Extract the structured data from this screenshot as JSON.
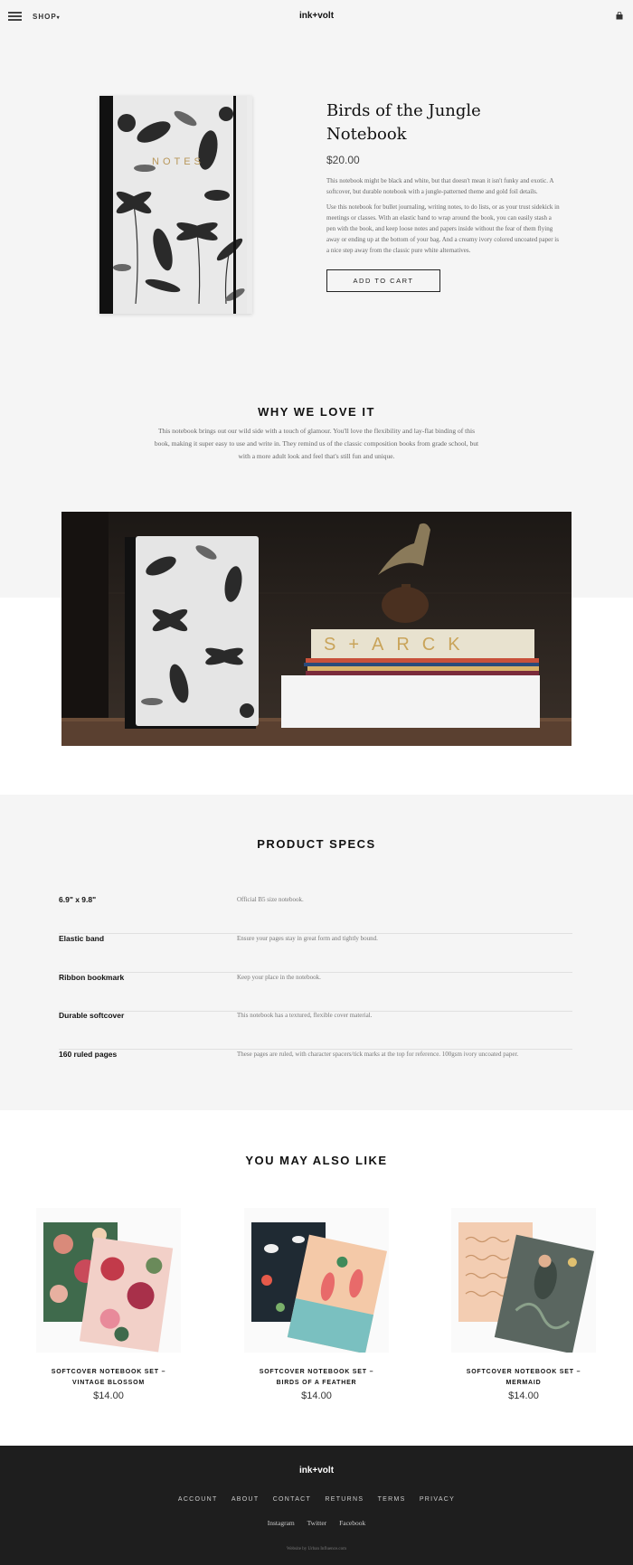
{
  "header": {
    "shop_label": "SHOP",
    "logo": "ink+volt"
  },
  "product": {
    "title": "Birds of the Jungle Notebook",
    "price": "$20.00",
    "cover_text": "NOTES",
    "description_1": "This notebook might be black and white, but that doesn't mean it isn't funky and exotic. A softcover, but durable notebook with a jungle-patterned theme and gold foil details.",
    "description_2": "Use this notebook for bullet journaling, writing notes, to do lists, or as your trust sidekick in meetings or classes. With an elastic band to wrap around the book, you can easily stash a pen with the book, and keep loose notes and papers inside without the fear of them flying away or ending up at the bottom of your bag. And a creamy ivory colored uncoated paper is a nice step away from the classic pure white alternatives.",
    "add_to_cart": "ADD TO CART"
  },
  "why": {
    "heading": "WHY WE LOVE IT",
    "text": "This notebook brings out our wild side with a touch of glamour. You'll love the flexibility and lay-flat binding of this book, making it super easy to use and write in. They remind us of the classic composition books from grade school, but with a more adult look and feel that's still fun and unique.",
    "book_spine_text": "S+ARCK"
  },
  "specs": {
    "heading": "PRODUCT SPECS",
    "rows": [
      {
        "name": "6.9\" x 9.8\"",
        "desc": "Official B5 size notebook."
      },
      {
        "name": "Elastic band",
        "desc": "Ensure your pages stay in great form and tightly bound."
      },
      {
        "name": "Ribbon bookmark",
        "desc": "Keep your place in the notebook."
      },
      {
        "name": "Durable softcover",
        "desc": "This notebook has a textured, flexible cover material."
      },
      {
        "name": "160 ruled pages",
        "desc": "These pages are ruled, with character spacers/tick marks at the top for reference. 100gsm ivory uncoated paper."
      }
    ]
  },
  "also_like": {
    "heading": "YOU MAY ALSO LIKE",
    "items": [
      {
        "name_line1": "SOFTCOVER NOTEBOOK SET –",
        "name_line2": "VINTAGE BLOSSOM",
        "price": "$14.00"
      },
      {
        "name_line1": "SOFTCOVER NOTEBOOK SET –",
        "name_line2": "BIRDS OF A FEATHER",
        "price": "$14.00"
      },
      {
        "name_line1": "SOFTCOVER NOTEBOOK SET –",
        "name_line2": "MERMAID",
        "price": "$14.00"
      }
    ]
  },
  "footer": {
    "logo": "ink+volt",
    "nav": [
      "ACCOUNT",
      "ABOUT",
      "CONTACT",
      "RETURNS",
      "TERMS",
      "PRIVACY"
    ],
    "social": [
      "Instagram",
      "Twitter",
      "Facebook"
    ],
    "credit": "Website by Urban Influence.com"
  },
  "colors": {
    "background": "#f5f5f5",
    "footer": "#1e1e1e",
    "text": "#111111",
    "gold": "#b8975a"
  }
}
